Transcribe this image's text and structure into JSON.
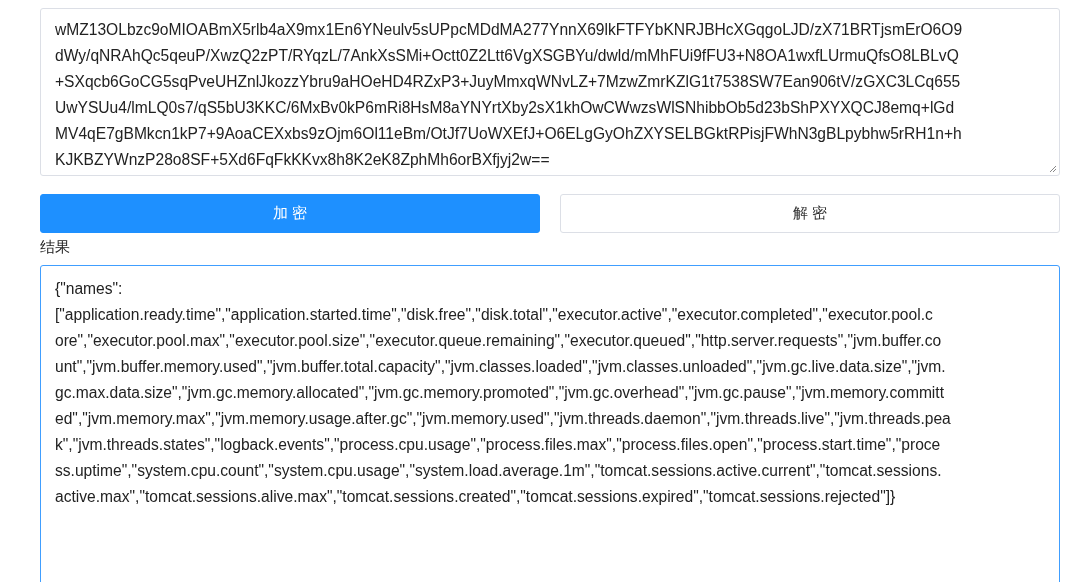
{
  "cipher_field": {
    "lines": [
      "wMZ13OLbzc9oMIOABmX5rlb4aX9mx1En6YNeulv5sUPpcMDdMA277YnnX69lkFTFYbKNRJBHcXGqgoLJD/zX71BRTjsmErO6O9",
      "dWy/qNRAhQc5qeuP/XwzQ2zPT/RYqzL/7AnkXsSMi+Octt0Z2Ltt6VgXSGBYu/dwld/mMhFUi9fFU3+N8OA1wxfLUrmuQfsO8LBLvQ",
      "+SXqcb6GoCG5sqPveUHZnlJkozzYbru9aHOeHD4RZxP3+JuyMmxqWNvLZ+7MzwZmrKZlG1t7538SW7Ean906tV/zGXC3LCq655",
      "UwYSUu4/lmLQ0s7/qS5bU3KKC/6MxBv0kP6mRi8HsM8aYNYrtXby2sX1khOwCWwzsWlSNhibbOb5d23bShPXYXQCJ8emq+lGd",
      "MV4qE7gBMkcn1kP7+9AoaCEXxbs9zOjm6Ol11eBm/OtJf7UoWXEfJ+O6ELgGyOhZXYSELBGktRPisjFWhN3gBLpybhw5rRH1n+h",
      "KJKBZYWnzP28o8SF+5Xd6FqFkKKvx8h8K2eK8ZphMh6orBXfjyj2w=="
    ]
  },
  "buttons": [
    {
      "kind": "primary",
      "label": "加 密"
    },
    {
      "kind": "default",
      "label": "解 密"
    }
  ],
  "result_label": "结果",
  "result_field": {
    "focused": true,
    "lines": [
      "{\"names\":",
      "[\"application.ready.time\",\"application.started.time\",\"disk.free\",\"disk.total\",\"executor.active\",\"executor.completed\",\"executor.pool.c",
      "ore\",\"executor.pool.max\",\"executor.pool.size\",\"executor.queue.remaining\",\"executor.queued\",\"http.server.requests\",\"jvm.buffer.co",
      "unt\",\"jvm.buffer.memory.used\",\"jvm.buffer.total.capacity\",\"jvm.classes.loaded\",\"jvm.classes.unloaded\",\"jvm.gc.live.data.size\",\"jvm.",
      "gc.max.data.size\",\"jvm.gc.memory.allocated\",\"jvm.gc.memory.promoted\",\"jvm.gc.overhead\",\"jvm.gc.pause\",\"jvm.memory.committ",
      "ed\",\"jvm.memory.max\",\"jvm.memory.usage.after.gc\",\"jvm.memory.used\",\"jvm.threads.daemon\",\"jvm.threads.live\",\"jvm.threads.pea",
      "k\",\"jvm.threads.states\",\"logback.events\",\"process.cpu.usage\",\"process.files.max\",\"process.files.open\",\"process.start.time\",\"proce",
      "ss.uptime\",\"system.cpu.count\",\"system.cpu.usage\",\"system.load.average.1m\",\"tomcat.sessions.active.current\",\"tomcat.sessions.",
      "active.max\",\"tomcat.sessions.alive.max\",\"tomcat.sessions.created\",\"tomcat.sessions.expired\",\"tomcat.sessions.rejected\"]}"
    ]
  }
}
